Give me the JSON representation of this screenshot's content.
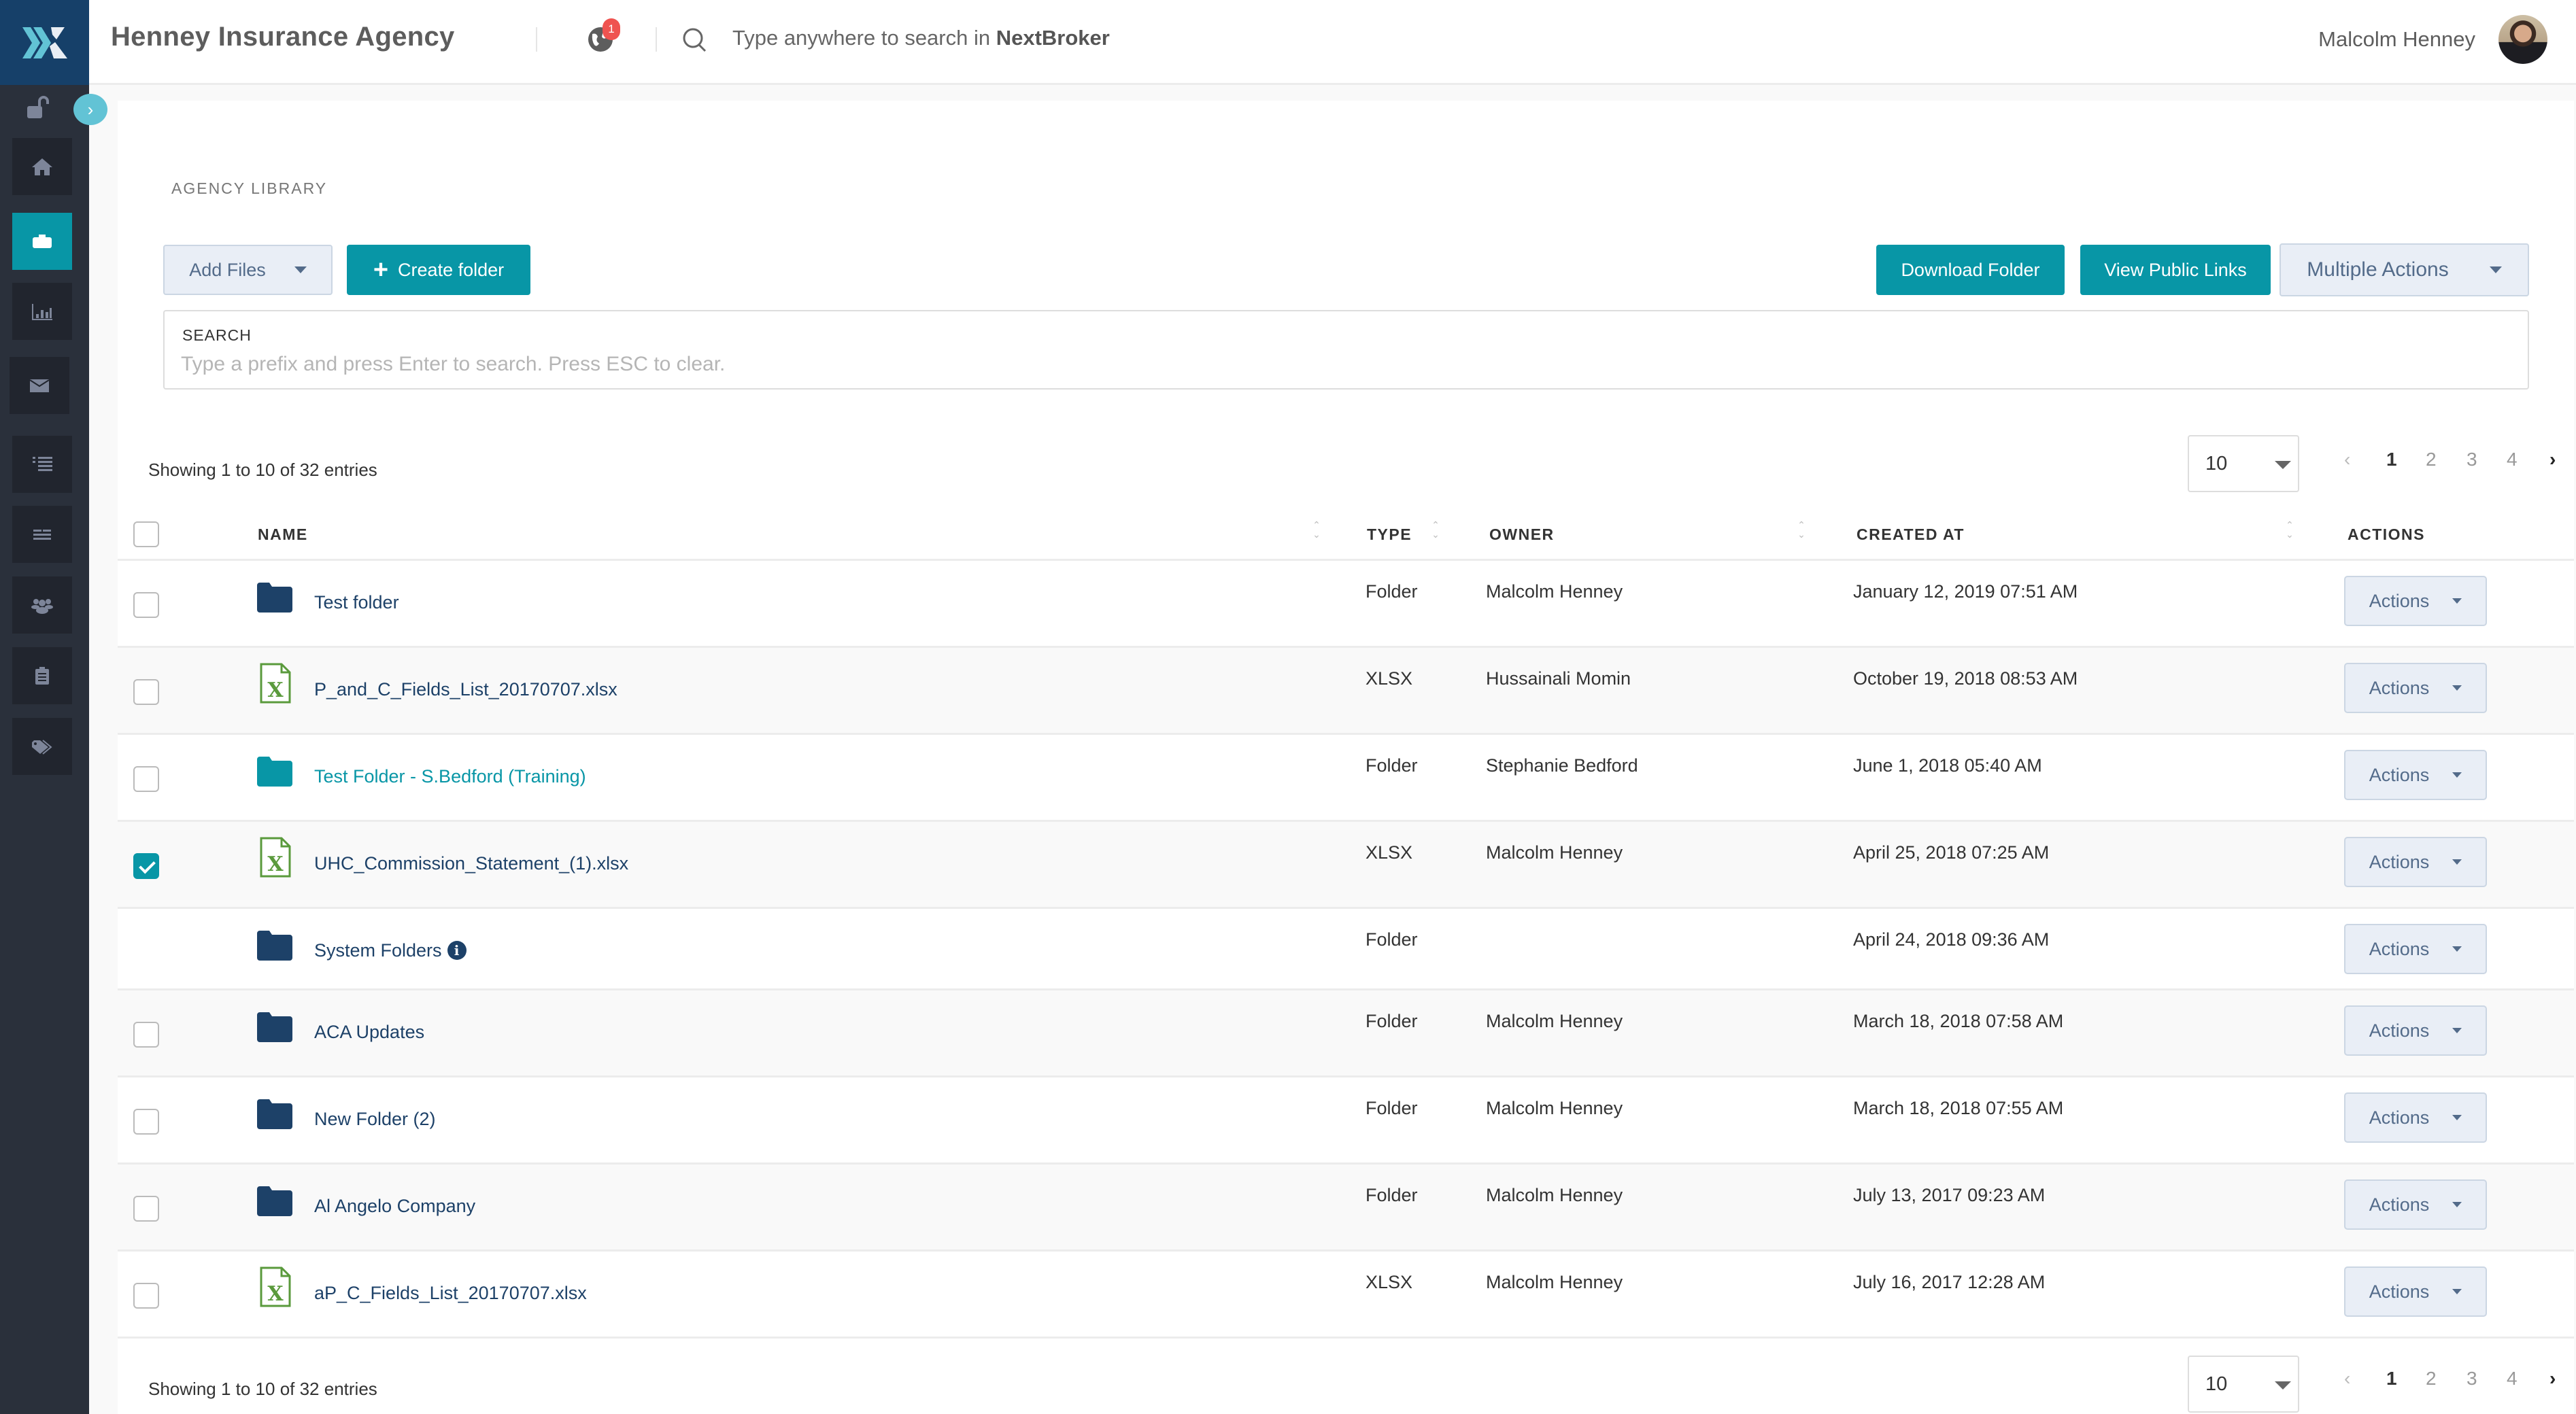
{
  "header": {
    "app_title": "Henney Insurance Agency",
    "notification_count": "1",
    "search_prefix": "Type anywhere to search in ",
    "search_brand": "NextBroker",
    "user_name": "Malcolm Henney"
  },
  "sidebar": {
    "items": [
      {
        "name": "home",
        "icon": "home-icon",
        "active": false
      },
      {
        "name": "library",
        "icon": "briefcase-icon",
        "active": true
      },
      {
        "name": "reports",
        "icon": "bar-chart-icon",
        "active": false
      },
      {
        "name": "mail",
        "icon": "envelope-icon",
        "active": false
      },
      {
        "name": "list",
        "icon": "list-icon",
        "active": false
      },
      {
        "name": "menu",
        "icon": "lines-icon",
        "active": false
      },
      {
        "name": "users",
        "icon": "users-icon",
        "active": false
      },
      {
        "name": "tasks",
        "icon": "clipboard-icon",
        "active": false
      },
      {
        "name": "tags",
        "icon": "tags-icon",
        "active": false
      }
    ]
  },
  "page": {
    "section_title": "AGENCY LIBRARY",
    "add_files_label": "Add Files",
    "create_folder_label": "Create folder",
    "download_folder_label": "Download Folder",
    "view_public_links_label": "View Public Links",
    "multiple_actions_label": "Multiple Actions",
    "search_label": "SEARCH",
    "search_placeholder": "Type a prefix and press Enter to search. Press ESC to clear.",
    "search_value": ""
  },
  "listing": {
    "showing_text": "Showing 1 to 10 of 32 entries",
    "page_size": "10",
    "pages": [
      "1",
      "2",
      "3",
      "4"
    ],
    "current_page": "1",
    "prev": "‹",
    "next": "›"
  },
  "table": {
    "columns": {
      "name": "NAME",
      "type": "TYPE",
      "owner": "OWNER",
      "created_at": "CREATED AT",
      "actions": "ACTIONS"
    },
    "action_label": "Actions",
    "rows": [
      {
        "name": "Test folder",
        "kind": "folder",
        "type": "Folder",
        "owner": "Malcolm Henney",
        "created_at": "January 12, 2019 07:51 AM",
        "checked": false,
        "selectable": true,
        "info": false,
        "shared": false
      },
      {
        "name": "P_and_C_Fields_List_20170707.xlsx",
        "kind": "xlsx",
        "type": "XLSX",
        "owner": "Hussainali Momin",
        "created_at": "October 19, 2018 08:53 AM",
        "checked": false,
        "selectable": true,
        "info": false,
        "shared": false
      },
      {
        "name": "Test Folder - S.Bedford (Training)",
        "kind": "folder",
        "type": "Folder",
        "owner": "Stephanie Bedford",
        "created_at": "June 1, 2018 05:40 AM",
        "checked": false,
        "selectable": true,
        "info": false,
        "shared": true
      },
      {
        "name": "UHC_Commission_Statement_(1).xlsx",
        "kind": "xlsx",
        "type": "XLSX",
        "owner": "Malcolm Henney",
        "created_at": "April 25, 2018 07:25 AM",
        "checked": true,
        "selectable": true,
        "info": false,
        "shared": false
      },
      {
        "name": "System Folders",
        "kind": "folder",
        "type": "Folder",
        "owner": "",
        "created_at": "April 24, 2018 09:36 AM",
        "checked": false,
        "selectable": false,
        "info": true,
        "shared": false
      },
      {
        "name": "ACA Updates",
        "kind": "folder",
        "type": "Folder",
        "owner": "Malcolm Henney",
        "created_at": "March 18, 2018 07:58 AM",
        "checked": false,
        "selectable": true,
        "info": false,
        "shared": false
      },
      {
        "name": "New Folder (2)",
        "kind": "folder",
        "type": "Folder",
        "owner": "Malcolm Henney",
        "created_at": "March 18, 2018 07:55 AM",
        "checked": false,
        "selectable": true,
        "info": false,
        "shared": false
      },
      {
        "name": "Al Angelo Company",
        "kind": "folder",
        "type": "Folder",
        "owner": "Malcolm Henney",
        "created_at": "July 13, 2017 09:23 AM",
        "checked": false,
        "selectable": true,
        "info": false,
        "shared": false
      },
      {
        "name": "aP_C_Fields_List_20170707.xlsx",
        "kind": "xlsx",
        "type": "XLSX",
        "owner": "Malcolm Henney",
        "created_at": "July 16, 2017 12:28 AM",
        "checked": false,
        "selectable": true,
        "info": false,
        "shared": false
      }
    ]
  },
  "colors": {
    "brand_navy": "#164069",
    "sidebar_bg": "#2a303b",
    "accent_teal": "#0896a6",
    "folder_navy": "#1d4168",
    "excel_green": "#5a9a3c",
    "notification_red": "#ef5350"
  }
}
